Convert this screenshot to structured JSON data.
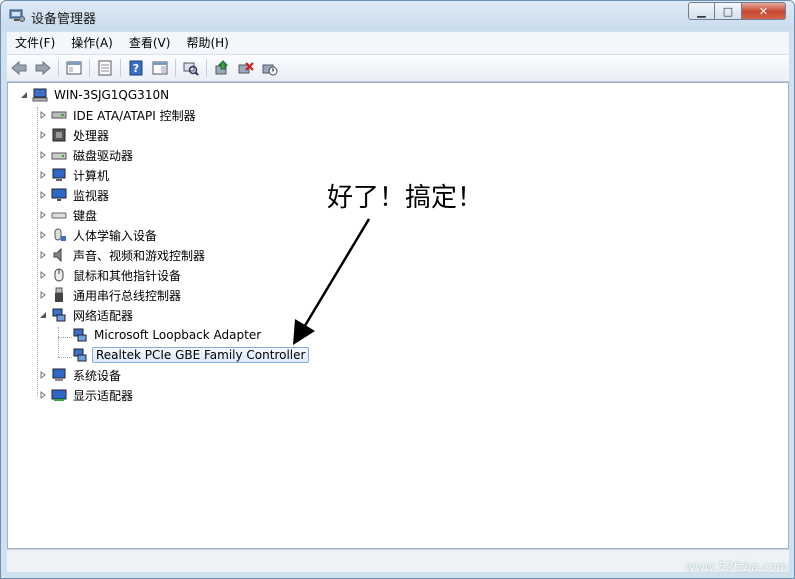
{
  "window": {
    "title": "设备管理器",
    "buttons": {
      "minimize": "▁",
      "maximize": "□",
      "close": "✕"
    }
  },
  "menu": [
    "文件(F)",
    "操作(A)",
    "查看(V)",
    "帮助(H)"
  ],
  "toolbar_icons": [
    "back-arrow-icon",
    "forward-arrow-icon",
    "show-hide-console-tree-icon",
    "properties-icon",
    "help-icon",
    "action-pane-icon",
    "scan-hardware-icon",
    "update-driver-icon",
    "uninstall-icon",
    "disable-icon"
  ],
  "tree": {
    "root": "WIN-3SJG1QG310N",
    "categories": [
      {
        "label": "IDE ATA/ATAPI 控制器",
        "icon": "ide-controller-icon"
      },
      {
        "label": "处理器",
        "icon": "processor-icon"
      },
      {
        "label": "磁盘驱动器",
        "icon": "disk-drive-icon"
      },
      {
        "label": "计算机",
        "icon": "computer-icon"
      },
      {
        "label": "监视器",
        "icon": "monitor-icon"
      },
      {
        "label": "键盘",
        "icon": "keyboard-icon"
      },
      {
        "label": "人体学输入设备",
        "icon": "hid-icon"
      },
      {
        "label": "声音、视频和游戏控制器",
        "icon": "speaker-icon"
      },
      {
        "label": "鼠标和其他指针设备",
        "icon": "mouse-icon"
      },
      {
        "label": "通用串行总线控制器",
        "icon": "usb-icon"
      },
      {
        "label": "网络适配器",
        "icon": "network-adapter-icon",
        "expanded": true,
        "children": [
          {
            "label": "Microsoft Loopback Adapter"
          },
          {
            "label": "Realtek PCIe GBE Family Controller",
            "selected": true
          }
        ]
      },
      {
        "label": "系统设备",
        "icon": "system-device-icon"
      },
      {
        "label": "显示适配器",
        "icon": "display-adapter-icon"
      }
    ]
  },
  "annotation": "好了！搞定！",
  "watermark": "www.52fzba.com"
}
